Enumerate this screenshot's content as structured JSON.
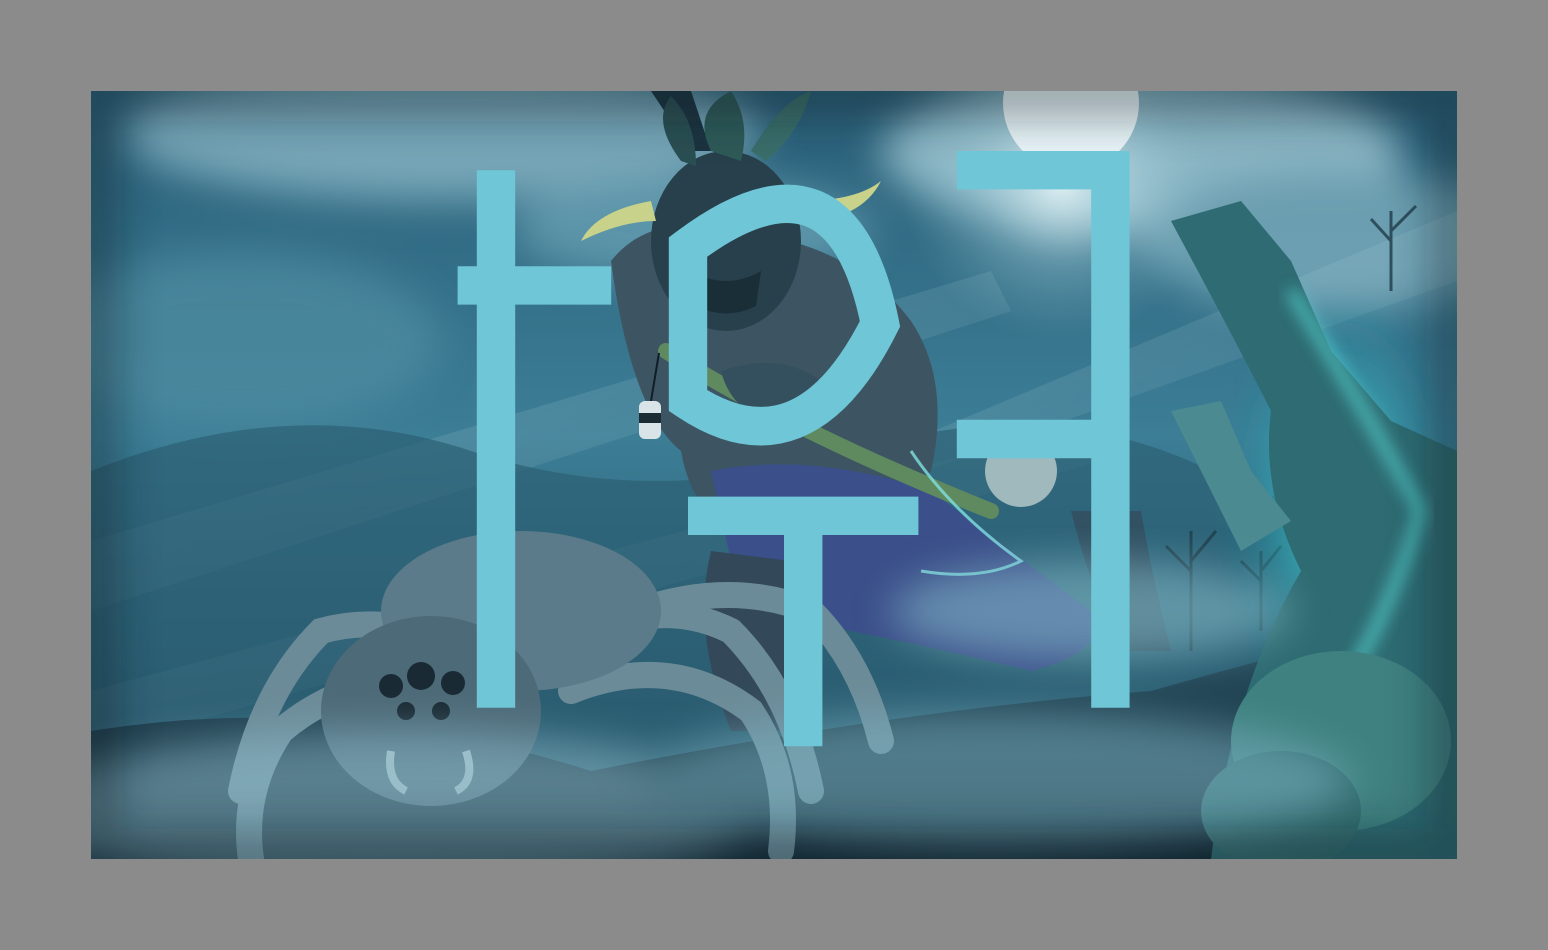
{
  "colors": {
    "mat": "#8b8b8b",
    "sky_top": "#2f6a82",
    "sky_mid": "#3a7b93",
    "fog": "#7fb3c4",
    "moon": "#e8f4f7",
    "ground_dark": "#122a36",
    "glow_cyan": "#3fe0e0",
    "robe": "#3b4f8a",
    "spider": "#5b7b8a"
  },
  "icons": {
    "moon": "moon-icon",
    "signature": "artist-signature"
  }
}
